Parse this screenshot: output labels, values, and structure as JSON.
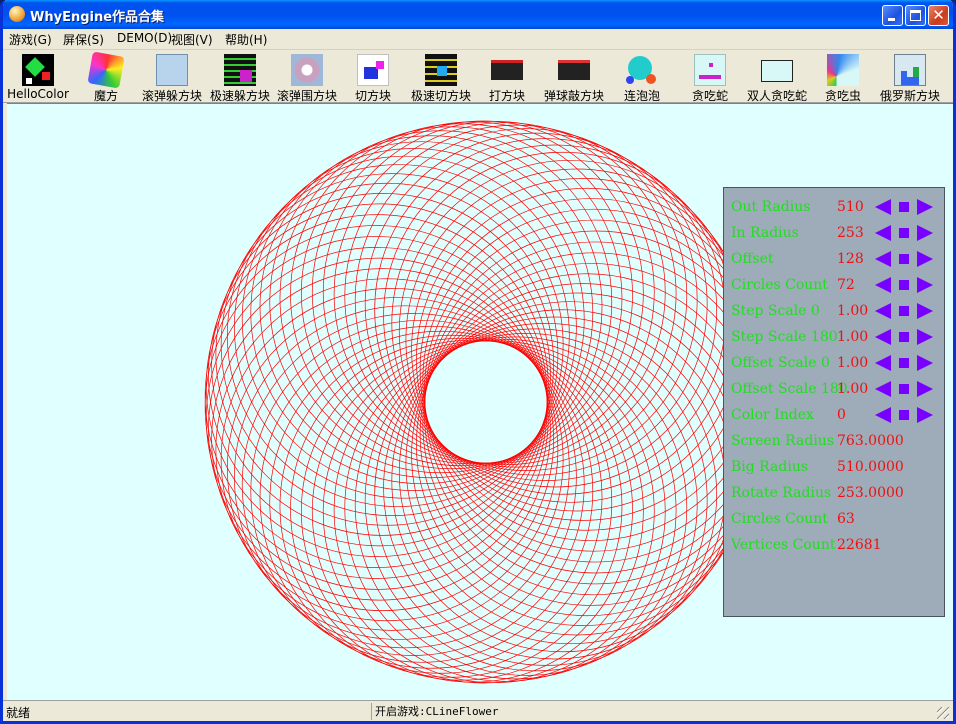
{
  "window": {
    "title": "WhyEngine作品合集",
    "controls": {
      "minimize": "minimize",
      "maximize": "maximize",
      "close": "✕"
    }
  },
  "menu": [
    "游戏(G)",
    "屏保(S)",
    "DEMO(D)",
    "视图(V)",
    "帮助(H)"
  ],
  "toolbar": [
    {
      "label": "HelloColor",
      "icon": "hellocolor-icon"
    },
    {
      "label": "魔方",
      "icon": "rubiks-cube-icon"
    },
    {
      "label": "滚弹躲方块",
      "icon": "rolling-dodge-icon"
    },
    {
      "label": "极速躲方块",
      "icon": "speed-dodge-icon"
    },
    {
      "label": "滚弹围方块",
      "icon": "rolling-surround-icon"
    },
    {
      "label": "切方块",
      "icon": "cut-block-icon"
    },
    {
      "label": "极速切方块",
      "icon": "speed-cut-icon"
    },
    {
      "label": "打方块",
      "icon": "hit-block-icon"
    },
    {
      "label": "弹球敲方块",
      "icon": "ball-knock-icon"
    },
    {
      "label": "连泡泡",
      "icon": "bubbles-icon"
    },
    {
      "label": "贪吃蛇",
      "icon": "snake-icon"
    },
    {
      "label": "双人贪吃蛇",
      "icon": "two-player-snake-icon"
    },
    {
      "label": "贪吃虫",
      "icon": "worm-icon"
    },
    {
      "label": "俄罗斯方块",
      "icon": "tetris-icon"
    }
  ],
  "canvas": {
    "background": "#e0ffff",
    "line_color": "#ff0000"
  },
  "params": [
    {
      "label": "Out Radius",
      "value": "510",
      "controls": true
    },
    {
      "label": "In Radius",
      "value": "253",
      "controls": true
    },
    {
      "label": "Offset",
      "value": "128",
      "controls": true
    },
    {
      "label": "Circles Count",
      "value": "72",
      "controls": true
    },
    {
      "label": "Step Scale 0",
      "value": "1.00",
      "controls": true
    },
    {
      "label": "Step Scale 180",
      "value": "1.00",
      "controls": true
    },
    {
      "label": "Offset Scale 0",
      "value": "1.00",
      "controls": true
    },
    {
      "label": "Offset Scale 180",
      "value": "1.00",
      "controls": true
    },
    {
      "label": "Color Index",
      "value": "0",
      "controls": true
    },
    {
      "label": "Screen Radius",
      "value": "763.0000",
      "controls": false
    },
    {
      "label": "Big Radius",
      "value": "510.0000",
      "controls": false
    },
    {
      "label": "Rotate Radius",
      "value": "253.0000",
      "controls": false
    },
    {
      "label": "Circles Count",
      "value": "63",
      "controls": false
    },
    {
      "label": "Vertices Count",
      "value": "22681",
      "controls": false
    }
  ],
  "status": {
    "left": "就绪",
    "right": "开启游戏:CLineFlower"
  }
}
